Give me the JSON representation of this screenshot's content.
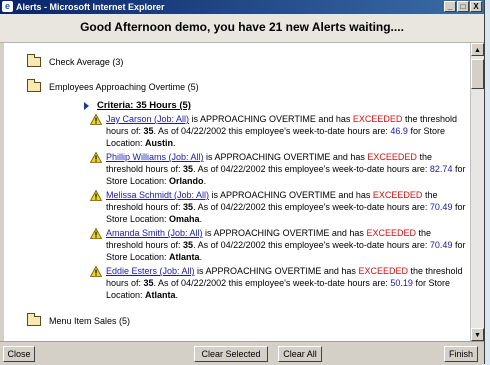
{
  "window": {
    "title": "Alerts - Microsoft Internet Explorer",
    "minimize": "_",
    "maximize": "□",
    "close": "X"
  },
  "banner": "Good Afternoon demo, you have 21 new Alerts waiting....",
  "groups": [
    {
      "label": "Check Average (3)"
    },
    {
      "label": "Employees Approaching Overtime (5)"
    },
    {
      "label": "Menu Item Sales (5)"
    }
  ],
  "criteria": "Criteria: 35 Hours (5)",
  "alerts": [
    {
      "employee": "Jay Carson (Job: All)",
      "text_a": " is APPROACHING OVERTIME and has ",
      "exceeded": "EXCEEDED",
      "text_b": " the threshold hours of: ",
      "threshold": "35",
      "text_c": ". As of 04/22/2002 this employee's week-to-date hours are: ",
      "hours": "46.9",
      "text_d": " for Store Location: ",
      "location": "Austin",
      "end": "."
    },
    {
      "employee": "Phillip Williams (Job: All)",
      "text_a": " is APPROACHING OVERTIME and has ",
      "exceeded": "EXCEEDED",
      "text_b": " the threshold hours of: ",
      "threshold": "35",
      "text_c": ". As of 04/22/2002 this employee's week-to-date hours are: ",
      "hours": "82.74",
      "text_d": " for Store Location: ",
      "location": "Orlando",
      "end": "."
    },
    {
      "employee": "Melissa Schmidt (Job: All)",
      "text_a": " is APPROACHING OVERTIME and has ",
      "exceeded": "EXCEEDED",
      "text_b": " the threshold hours of: ",
      "threshold": "35",
      "text_c": ". As of 04/22/2002 this employee's week-to-date hours are: ",
      "hours": "70.49",
      "text_d": " for Store Location: ",
      "location": "Omaha",
      "end": "."
    },
    {
      "employee": "Amanda Smith (Job: All)",
      "text_a": " is APPROACHING OVERTIME and has ",
      "exceeded": "EXCEEDED",
      "text_b": " the threshold hours of: ",
      "threshold": "35",
      "text_c": ". As of 04/22/2002 this employee's week-to-date hours are: ",
      "hours": "70.49",
      "text_d": " for Store Location: ",
      "location": "Atlanta",
      "end": "."
    },
    {
      "employee": "Eddie Esters (Job: All)",
      "text_a": " is APPROACHING OVERTIME and has ",
      "exceeded": "EXCEEDED",
      "text_b": " the threshold hours of: ",
      "threshold": "35",
      "text_c": ". As of 04/22/2002 this employee's week-to-date hours are: ",
      "hours": "50.19",
      "text_d": " for Store Location: ",
      "location": "Atlanta",
      "end": "."
    }
  ],
  "footer": {
    "close": "Close",
    "clear_selected": "Clear Selected",
    "clear_all": "Clear All",
    "finish": "Finish"
  },
  "colors": {
    "title_bar": "#0a246a",
    "link": "#1a1aa8",
    "exceeded": "#d01010",
    "warning_icon": "#f2d21a"
  },
  "icons": [
    "ie-icon",
    "folder-icon",
    "criteria-arrow-icon",
    "warning-icon",
    "scroll-up-icon",
    "scroll-down-icon"
  ]
}
